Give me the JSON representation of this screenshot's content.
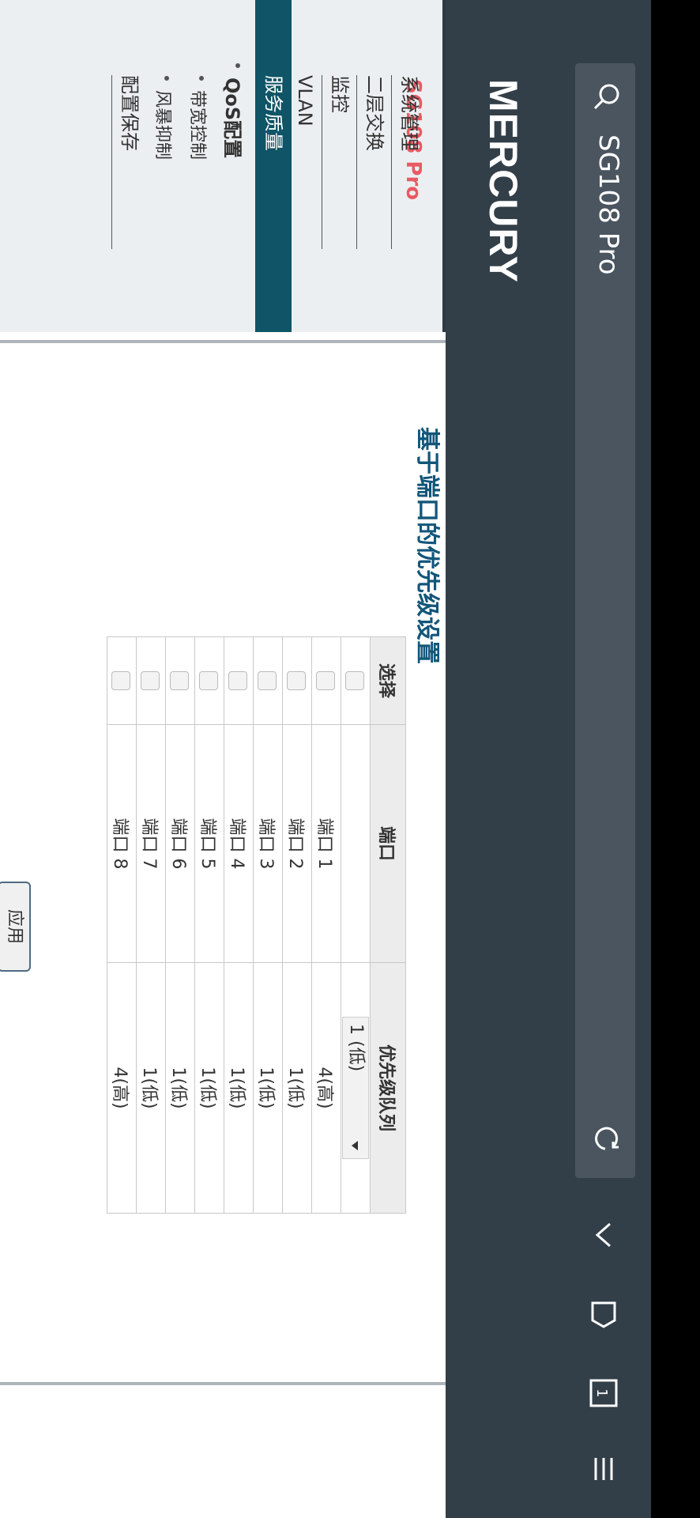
{
  "browser": {
    "url": "SG108 Pro",
    "icons": [
      "search-icon",
      "reload-icon",
      "chevron-down-icon",
      "tag-icon",
      "tabs-icon",
      "menu-icon"
    ],
    "tab_count": "1"
  },
  "header": {
    "logo": "MERCURY"
  },
  "sidebar": {
    "model": "SG108 Pro",
    "items": [
      {
        "label": "系统管理"
      },
      {
        "label": "二层交换"
      },
      {
        "label": "监控"
      },
      {
        "label": "VLAN"
      },
      {
        "label": "服务质量"
      }
    ],
    "submenu_title": "QoS配置",
    "subitems": [
      {
        "label": "带宽控制"
      },
      {
        "label": "风暴抑制"
      }
    ],
    "save_label": "配置保存"
  },
  "main": {
    "heading": "基于端口的优先级设置",
    "table": {
      "headers": [
        "选择",
        "端口",
        "优先级队列"
      ],
      "select_value": "1 (低)",
      "rows": [
        {
          "port": "端口 1",
          "priority": "4(高)"
        },
        {
          "port": "端口 2",
          "priority": "1(低)"
        },
        {
          "port": "端口 3",
          "priority": "1(低)"
        },
        {
          "port": "端口 4",
          "priority": "1(低)"
        },
        {
          "port": "端口 5",
          "priority": "1(低)"
        },
        {
          "port": "端口 6",
          "priority": "1(低)"
        },
        {
          "port": "端口 7",
          "priority": "1(低)"
        },
        {
          "port": "端口 8",
          "priority": "4(高)"
        }
      ]
    },
    "apply_label": "应用"
  },
  "colors": {
    "nav_dark": "#333f48",
    "active_menu": "#0f5467",
    "model_red": "#e85a64",
    "heading_blue": "#12567a"
  }
}
